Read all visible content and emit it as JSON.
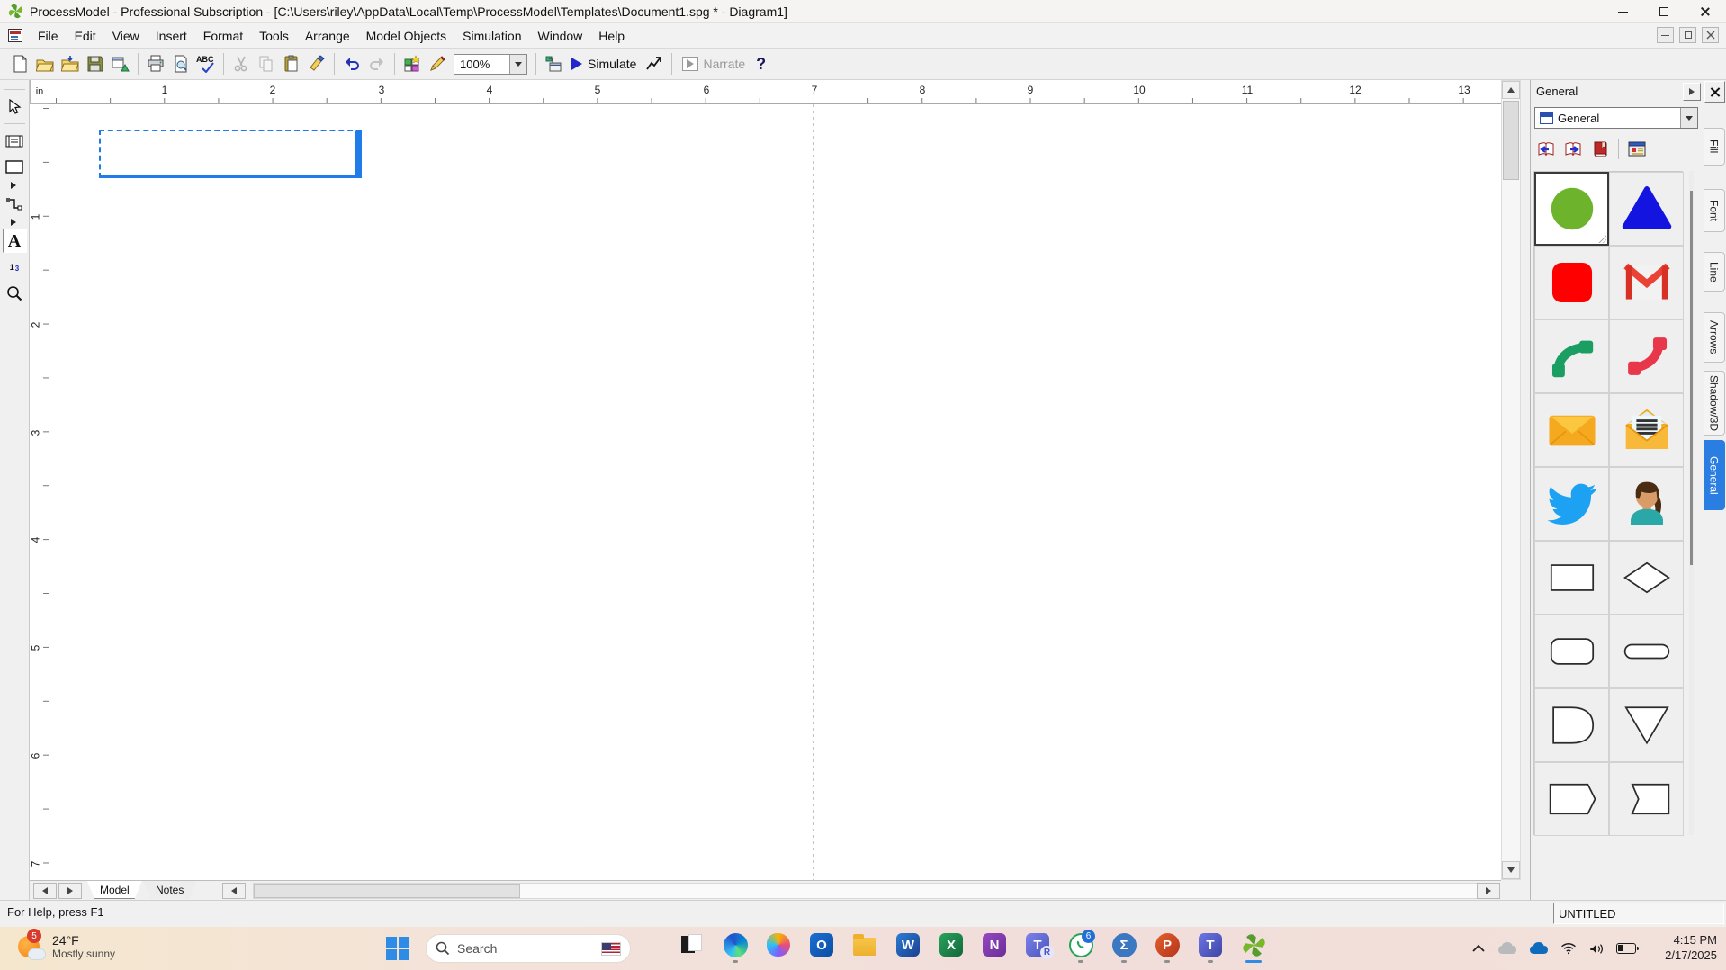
{
  "window": {
    "title": "ProcessModel - Professional Subscription - [C:\\Users\\riley\\AppData\\Local\\Temp\\ProcessModel\\Templates\\Document1.spg * - Diagram1]"
  },
  "menu": {
    "items": [
      "File",
      "Edit",
      "View",
      "Insert",
      "Format",
      "Tools",
      "Arrange",
      "Model Objects",
      "Simulation",
      "Window",
      "Help"
    ]
  },
  "toolbar": {
    "zoom_value": "100%",
    "spell_label": "ABC",
    "simulate_label": "Simulate",
    "narrate_label": "Narrate",
    "help_label": "?",
    "icons": [
      "new",
      "open",
      "open-folder",
      "save",
      "save-send",
      "print",
      "print-preview",
      "spell-check",
      "cut",
      "copy",
      "paste",
      "format-painter",
      "undo",
      "redo",
      "scenario",
      "pencil",
      "zoom-combo",
      "model-objects-window",
      "simulate",
      "stats-chart",
      "narrate",
      "help"
    ]
  },
  "tools": {
    "text_label": "A",
    "numbering_one": "1",
    "numbering_three": "3",
    "icons": [
      "pointer",
      "activity-box",
      "rectangle-tool",
      "flyout",
      "connector",
      "flyout",
      "text",
      "numbering",
      "zoom-magnifier"
    ]
  },
  "ruler": {
    "unit": "in",
    "h": [
      "1",
      "2",
      "3",
      "4",
      "5",
      "6",
      "7",
      "8",
      "9",
      "10",
      "11",
      "12",
      "13"
    ],
    "v": [
      "1",
      "2",
      "3",
      "4",
      "5",
      "6",
      "7"
    ]
  },
  "panel": {
    "title": "General",
    "combo_value": "General",
    "nav_icons": [
      "book-prev",
      "book-next",
      "book-red",
      "properties-window"
    ],
    "tabs": [
      "Fill",
      "Font",
      "Line",
      "Arrows",
      "Shadow/3D",
      "General"
    ],
    "active_tab": "General",
    "shapes": [
      "green-circle",
      "blue-triangle",
      "red-rounded-square",
      "gmail",
      "phone-green",
      "phone-red",
      "envelope-closed",
      "envelope-open",
      "twitter-bird",
      "person-avatar",
      "rectangle",
      "diamond",
      "rounded-rectangle",
      "stadium",
      "delay-shape",
      "inverted-triangle",
      "pointed-rectangle",
      "chevron-rectangle"
    ]
  },
  "sheet_tabs": {
    "model": "Model",
    "notes": "Notes"
  },
  "status": {
    "help_text": "For Help, press F1",
    "doc_name": "UNTITLED"
  },
  "taskbar": {
    "weather": {
      "badge": "5",
      "temp": "24°F",
      "desc": "Mostly sunny"
    },
    "search": {
      "label": "Search"
    },
    "apps": {
      "word": "W",
      "excel": "X",
      "onenote": "N",
      "outlook": "O",
      "teams": "T",
      "teams_badge": "R",
      "sigma": "Σ",
      "powerpoint": "P",
      "whatsapp_badge": "6"
    },
    "clock": {
      "time": "4:15 PM",
      "date": "2/17/2025"
    }
  }
}
